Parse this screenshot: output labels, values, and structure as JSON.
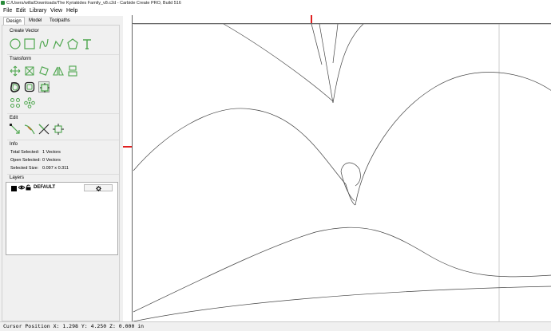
{
  "window": {
    "title": "C:/Users/willa/Downloads/The Kyriakides Family_v8.c2d - Carbide Create PRO, Build 516"
  },
  "menu": {
    "file": "File",
    "edit": "Edit",
    "library": "Library",
    "view": "View",
    "help": "Help"
  },
  "tabs": {
    "design": "Design",
    "model": "Model",
    "toolpaths": "Toolpaths"
  },
  "sections": {
    "create_vector": "Create Vector",
    "transform": "Transform",
    "edit": "Edit",
    "info": "Info",
    "layers": "Layers"
  },
  "info": {
    "total_selected_label": "Total Selected:",
    "total_selected_value": "1 Vectors",
    "open_selected_label": "Open Selected:",
    "open_selected_value": "0 Vectors",
    "selected_size_label": "Selected Size:",
    "selected_size_value": "0.097 x 0.311"
  },
  "layers": {
    "items": [
      {
        "name": "DEFAULT",
        "settings_icon": "gear-icon"
      }
    ]
  },
  "colors": {
    "tool_green": "#4ea64e",
    "marker_red": "#e02020"
  },
  "status": {
    "cursor": "Cursor Position X: 1.298 Y: 4.250 Z: 0.000 in"
  }
}
